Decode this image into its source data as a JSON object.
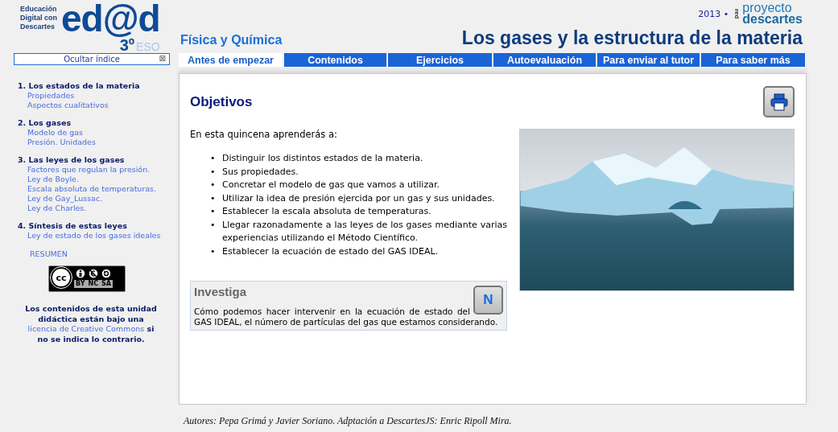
{
  "header": {
    "logo_caption": [
      "Educación",
      "Digital con",
      "Descartes"
    ],
    "logo": "ed@d",
    "level": "3º",
    "stage": "ESO",
    "year": "2013 •",
    "brand_small": "red",
    "brand": [
      "proyecto",
      "descartes"
    ],
    "subject": "Física y Química",
    "title": "Los gases y la estructura de la materia"
  },
  "index_toggle": {
    "label": "Ocultar índice",
    "icon": "⊠"
  },
  "tabs": [
    {
      "label": "Antes de empezar",
      "selected": true
    },
    {
      "label": "Contenidos",
      "selected": false
    },
    {
      "label": "Ejercicios",
      "selected": false
    },
    {
      "label": "Autoevaluación",
      "selected": false
    },
    {
      "label": "Para enviar al tutor",
      "selected": false
    },
    {
      "label": "Para saber más",
      "selected": false
    }
  ],
  "sidebar": {
    "items": [
      {
        "label": "1. Los estados de la materia",
        "children": [
          {
            "label": "Propiedades"
          },
          {
            "label": "Aspectos cualitativos"
          }
        ]
      },
      {
        "label": "2. Los gases",
        "children": [
          {
            "label": "Modelo de gas"
          },
          {
            "label": "Presión. Unidades"
          }
        ]
      },
      {
        "label": "3. Las leyes de los gases",
        "children": [
          {
            "label": "Factores que regulan la presión."
          },
          {
            "label": "Ley de Boyle."
          },
          {
            "label": "Escala absoluta de temperaturas."
          },
          {
            "label": "Ley de Gay_Lussac."
          },
          {
            "label": "Ley de Charles."
          }
        ]
      },
      {
        "label": "4. Síntesis de estas leyes",
        "children": [
          {
            "label": "Ley de estado de los gases ideales"
          }
        ]
      }
    ],
    "summary_link": "RESUMEN",
    "license_badge": {
      "mark": "cc",
      "terms": [
        "BY",
        "NC",
        "SA"
      ]
    },
    "license": {
      "before": "Los contenidos de esta unidad didáctica están bajo una",
      "link": "licencia de Creative Commons",
      "after": "si no se indica lo contrario."
    }
  },
  "content": {
    "heading": "Objetivos",
    "intro": "En esta quincena aprenderás a:",
    "bullet": "•",
    "objectives": [
      "Distinguir los distintos estados de la materia.",
      "Sus propiedades.",
      "Concretar el modelo de gas que vamos a utilizar.",
      "Utilizar la idea de presión ejercida por un gas y sus unidades.",
      "Establecer la escala absoluta de temperaturas.",
      "Llegar razonadamente a las leyes de los gases mediante varias experiencias utilizando el Método Científico.",
      "Establecer la ecuación de estado del GAS IDEAL."
    ],
    "investiga": {
      "title": "Investiga",
      "button_label": "N",
      "text": "Cómo podemos hacer intervenir en la ecuación de estado del GAS IDEAL, el número de partículas del gas que estamos considerando."
    }
  },
  "footer": "Autores: Pepa Grimá y Javier Soriano. Adptación a DescartesJS: Enric Ripoll Mira."
}
